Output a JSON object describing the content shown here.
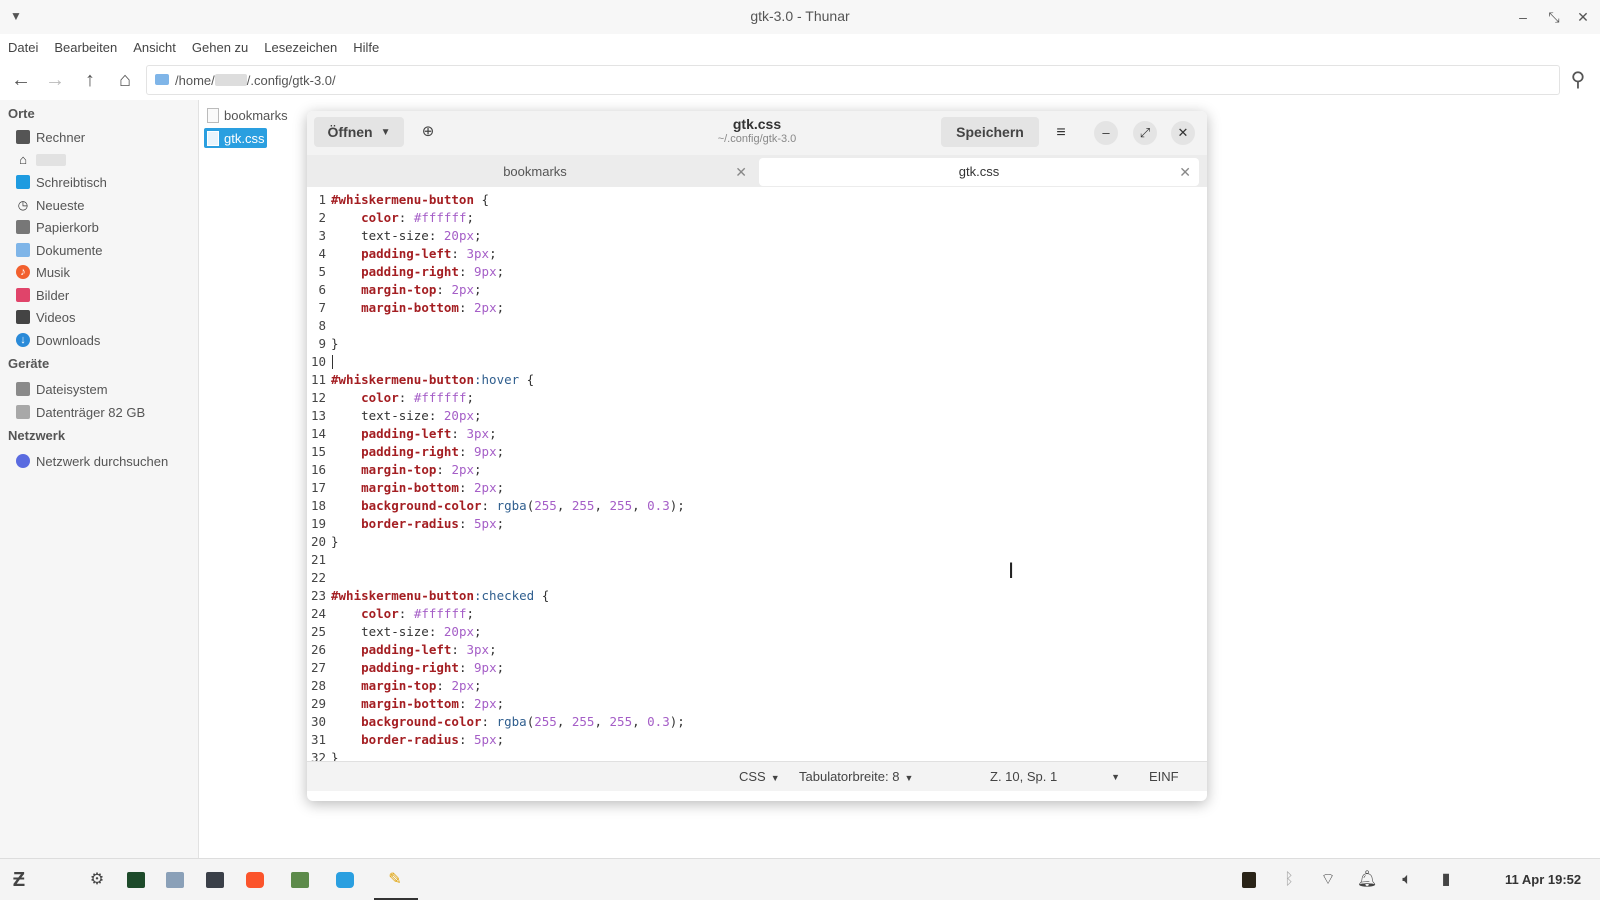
{
  "thunar": {
    "title": "gtk-3.0 - Thunar",
    "menu": [
      "Datei",
      "Bearbeiten",
      "Ansicht",
      "Gehen zu",
      "Lesezeichen",
      "Hilfe"
    ],
    "path_prefix": "/home/",
    "path_suffix": "/.config/gtk-3.0/",
    "sidebar": {
      "places_heading": "Orte",
      "places": [
        {
          "label": "Rechner",
          "icon": "computer-icon"
        },
        {
          "label": "",
          "icon": "home-icon"
        },
        {
          "label": "Schreibtisch",
          "icon": "desktop-icon"
        },
        {
          "label": "Neueste",
          "icon": "clock-icon"
        },
        {
          "label": "Papierkorb",
          "icon": "trash-icon"
        },
        {
          "label": "Dokumente",
          "icon": "folder-icon"
        },
        {
          "label": "Musik",
          "icon": "music-icon"
        },
        {
          "label": "Bilder",
          "icon": "pictures-icon"
        },
        {
          "label": "Videos",
          "icon": "video-icon"
        },
        {
          "label": "Downloads",
          "icon": "download-icon"
        }
      ],
      "devices_heading": "Geräte",
      "devices": [
        {
          "label": "Dateisystem",
          "icon": "drive-icon"
        },
        {
          "label": "Datenträger 82 GB",
          "icon": "drive-icon"
        }
      ],
      "network_heading": "Netzwerk",
      "network": [
        {
          "label": "Netzwerk durchsuchen",
          "icon": "network-icon"
        }
      ]
    },
    "files": [
      {
        "name": "bookmarks",
        "selected": false
      },
      {
        "name": "gtk.css",
        "selected": true
      }
    ]
  },
  "editor": {
    "open_label": "Öffnen",
    "title": "gtk.css",
    "subtitle": "~/.config/gtk-3.0",
    "save_label": "Speichern",
    "tabs": [
      {
        "label": "bookmarks",
        "active": false
      },
      {
        "label": "gtk.css",
        "active": true
      }
    ],
    "status": {
      "language": "CSS",
      "tab_width": "Tabulatorbreite: 8",
      "position": "Z. 10, Sp. 1",
      "mode": "EINF"
    },
    "code_lines": [
      "#whiskermenu-button {",
      "    color: #ffffff;",
      "    text-size: 20px;",
      "    padding-left: 3px;",
      "    padding-right: 9px;",
      "    margin-top: 2px;",
      "    margin-bottom: 2px;",
      "",
      "}",
      "",
      "#whiskermenu-button:hover {",
      "    color: #ffffff;",
      "    text-size: 20px;",
      "    padding-left: 3px;",
      "    padding-right: 9px;",
      "    margin-top: 2px;",
      "    margin-bottom: 2px;",
      "    background-color: rgba(255, 255, 255, 0.3);",
      "    border-radius: 5px;",
      "}",
      "",
      "",
      "#whiskermenu-button:checked {",
      "    color: #ffffff;",
      "    text-size: 20px;",
      "    padding-left: 3px;",
      "    padding-right: 9px;",
      "    margin-top: 2px;",
      "    margin-bottom: 2px;",
      "    background-color: rgba(255, 255, 255, 0.3);",
      "    border-radius: 5px;",
      "}"
    ]
  },
  "taskbar": {
    "clock": "11 Apr 19:52"
  }
}
